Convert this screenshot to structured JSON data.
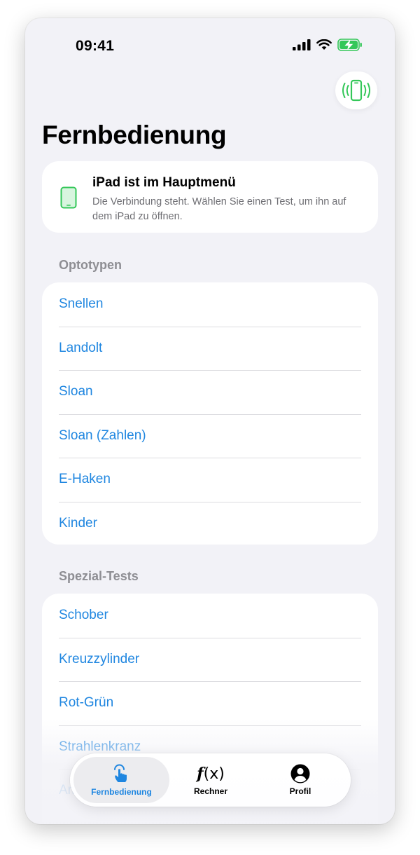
{
  "status_bar": {
    "time": "09:41"
  },
  "page_title": "Fernbedienung",
  "connection": {
    "heading": "iPad ist im Hauptmenü",
    "description": "Die Verbindung steht. Wählen Sie einen Test, um ihn auf dem iPad zu öffnen."
  },
  "sections": [
    {
      "header": "Optotypen",
      "items": [
        "Snellen",
        "Landolt",
        "Sloan",
        "Sloan (Zahlen)",
        "E-Haken",
        "Kinder"
      ]
    },
    {
      "header": "Spezial-Tests",
      "items": [
        "Schober",
        "Kreuzzylinder",
        "Rot-Grün",
        "Strahlenkranz",
        "Am"
      ]
    }
  ],
  "tabs": [
    {
      "label": "Fernbedienung",
      "icon": "hand-tap-icon",
      "active": true
    },
    {
      "label": "Rechner",
      "icon": "function-icon",
      "active": false
    },
    {
      "label": "Profil",
      "icon": "person-circle-icon",
      "active": false
    }
  ],
  "colors": {
    "accent": "#1f86e0",
    "success": "#34c759",
    "background": "#f2f2f7"
  }
}
